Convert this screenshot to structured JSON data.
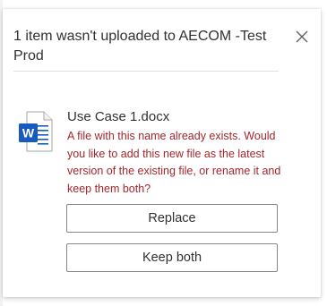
{
  "dialog": {
    "title": "1 item wasn't uploaded to AECOM -Test Prod",
    "close_icon": "close-icon"
  },
  "file": {
    "icon": "word-document-icon",
    "icon_letter": "W",
    "icon_color": "#185abd",
    "name": "Use Case 1.docx",
    "error": "A file with this name already exists. Would you like to add this new file as the latest version of the existing file, or rename it and keep them both?",
    "error_color": "#a4262c"
  },
  "actions": {
    "replace_label": "Replace",
    "keep_both_label": "Keep both"
  }
}
